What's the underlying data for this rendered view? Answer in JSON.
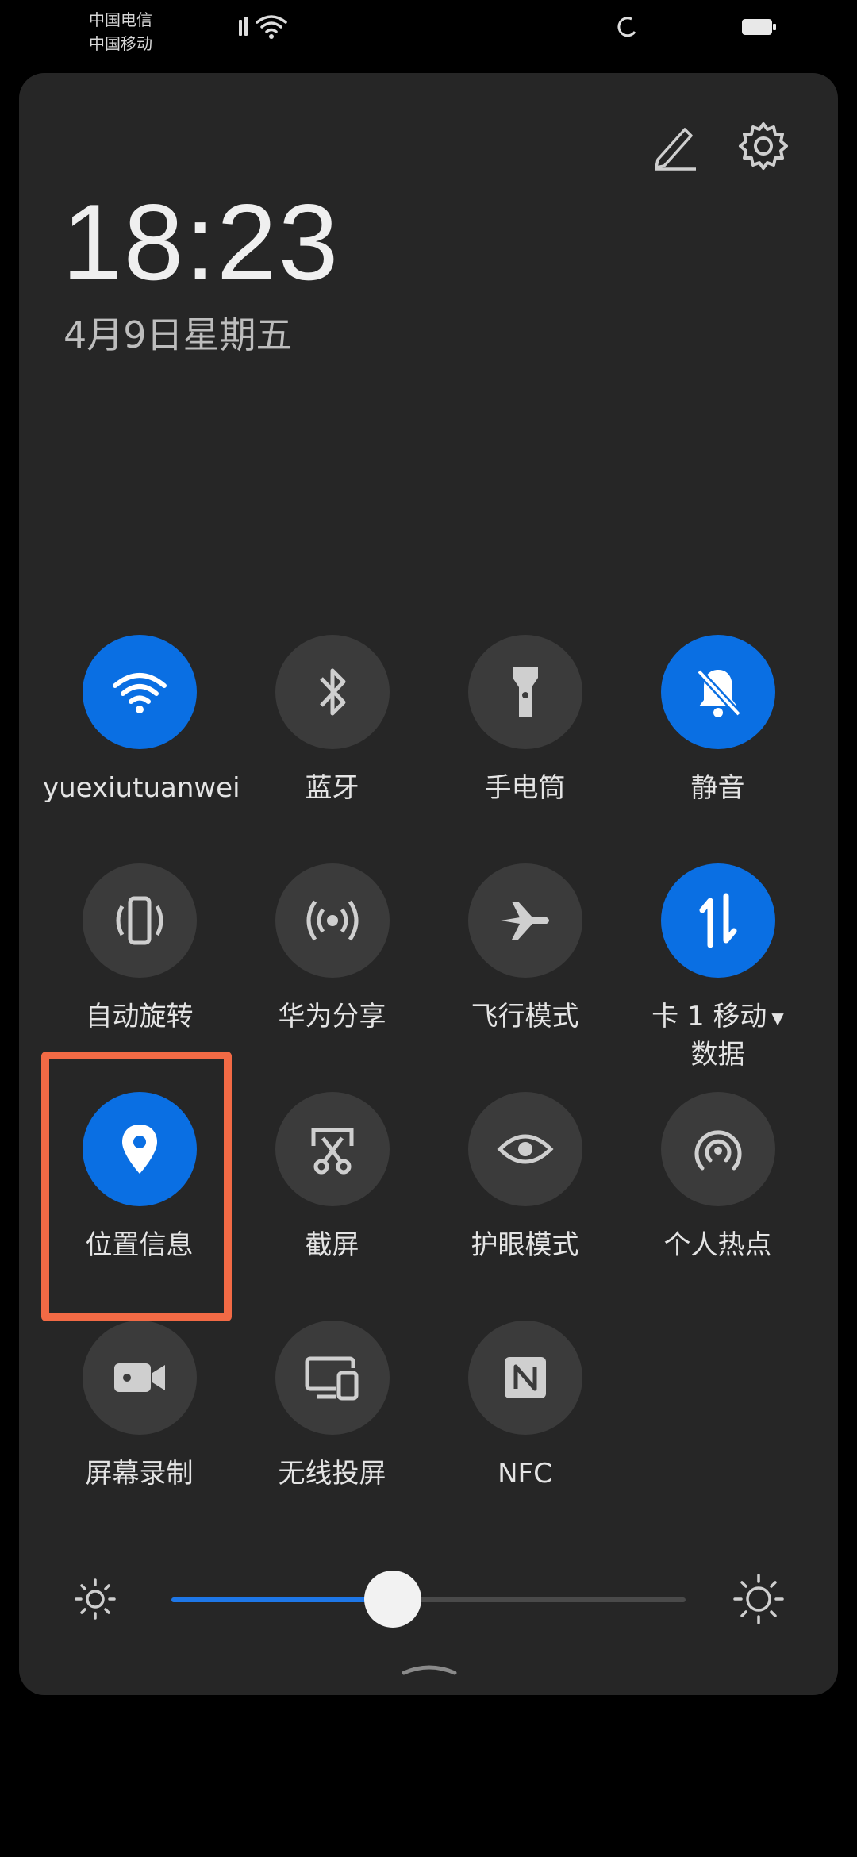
{
  "status_bar": {
    "carrier_1": "中国电信",
    "carrier_2": "中国移动"
  },
  "clock": {
    "time": "18:23",
    "date": "4月9日星期五"
  },
  "tiles": [
    {
      "label": "yuexiutuanwei",
      "icon": "wifi-icon",
      "on": true
    },
    {
      "label": "蓝牙",
      "icon": "bluetooth-icon",
      "on": false
    },
    {
      "label": "手电筒",
      "icon": "flashlight-icon",
      "on": false
    },
    {
      "label": "静音",
      "icon": "bell-off-icon",
      "on": true
    },
    {
      "label": "自动旋转",
      "icon": "auto-rotate-icon",
      "on": false
    },
    {
      "label": "华为分享",
      "icon": "share-icon",
      "on": false
    },
    {
      "label": "飞行模式",
      "icon": "airplane-icon",
      "on": false
    },
    {
      "label": "卡 1 移动",
      "label_line2": "数据",
      "icon": "mobile-data-icon",
      "on": true
    },
    {
      "label": "位置信息",
      "icon": "location-icon",
      "on": true
    },
    {
      "label": "截屏",
      "icon": "screenshot-icon",
      "on": false
    },
    {
      "label": "护眼模式",
      "icon": "eye-icon",
      "on": false
    },
    {
      "label": "个人热点",
      "icon": "hotspot-icon",
      "on": false
    },
    {
      "label": "屏幕录制",
      "icon": "screen-record-icon",
      "on": false
    },
    {
      "label": "无线投屏",
      "icon": "wireless-projection-icon",
      "on": false
    },
    {
      "label": "NFC",
      "icon": "nfc-icon",
      "on": false
    }
  ],
  "brightness": {
    "level": 0.43
  },
  "colors": {
    "accent": "#0a6fe3",
    "panel": "#262626",
    "tile_off": "#3b3b3b",
    "highlight": "#f26a45"
  }
}
